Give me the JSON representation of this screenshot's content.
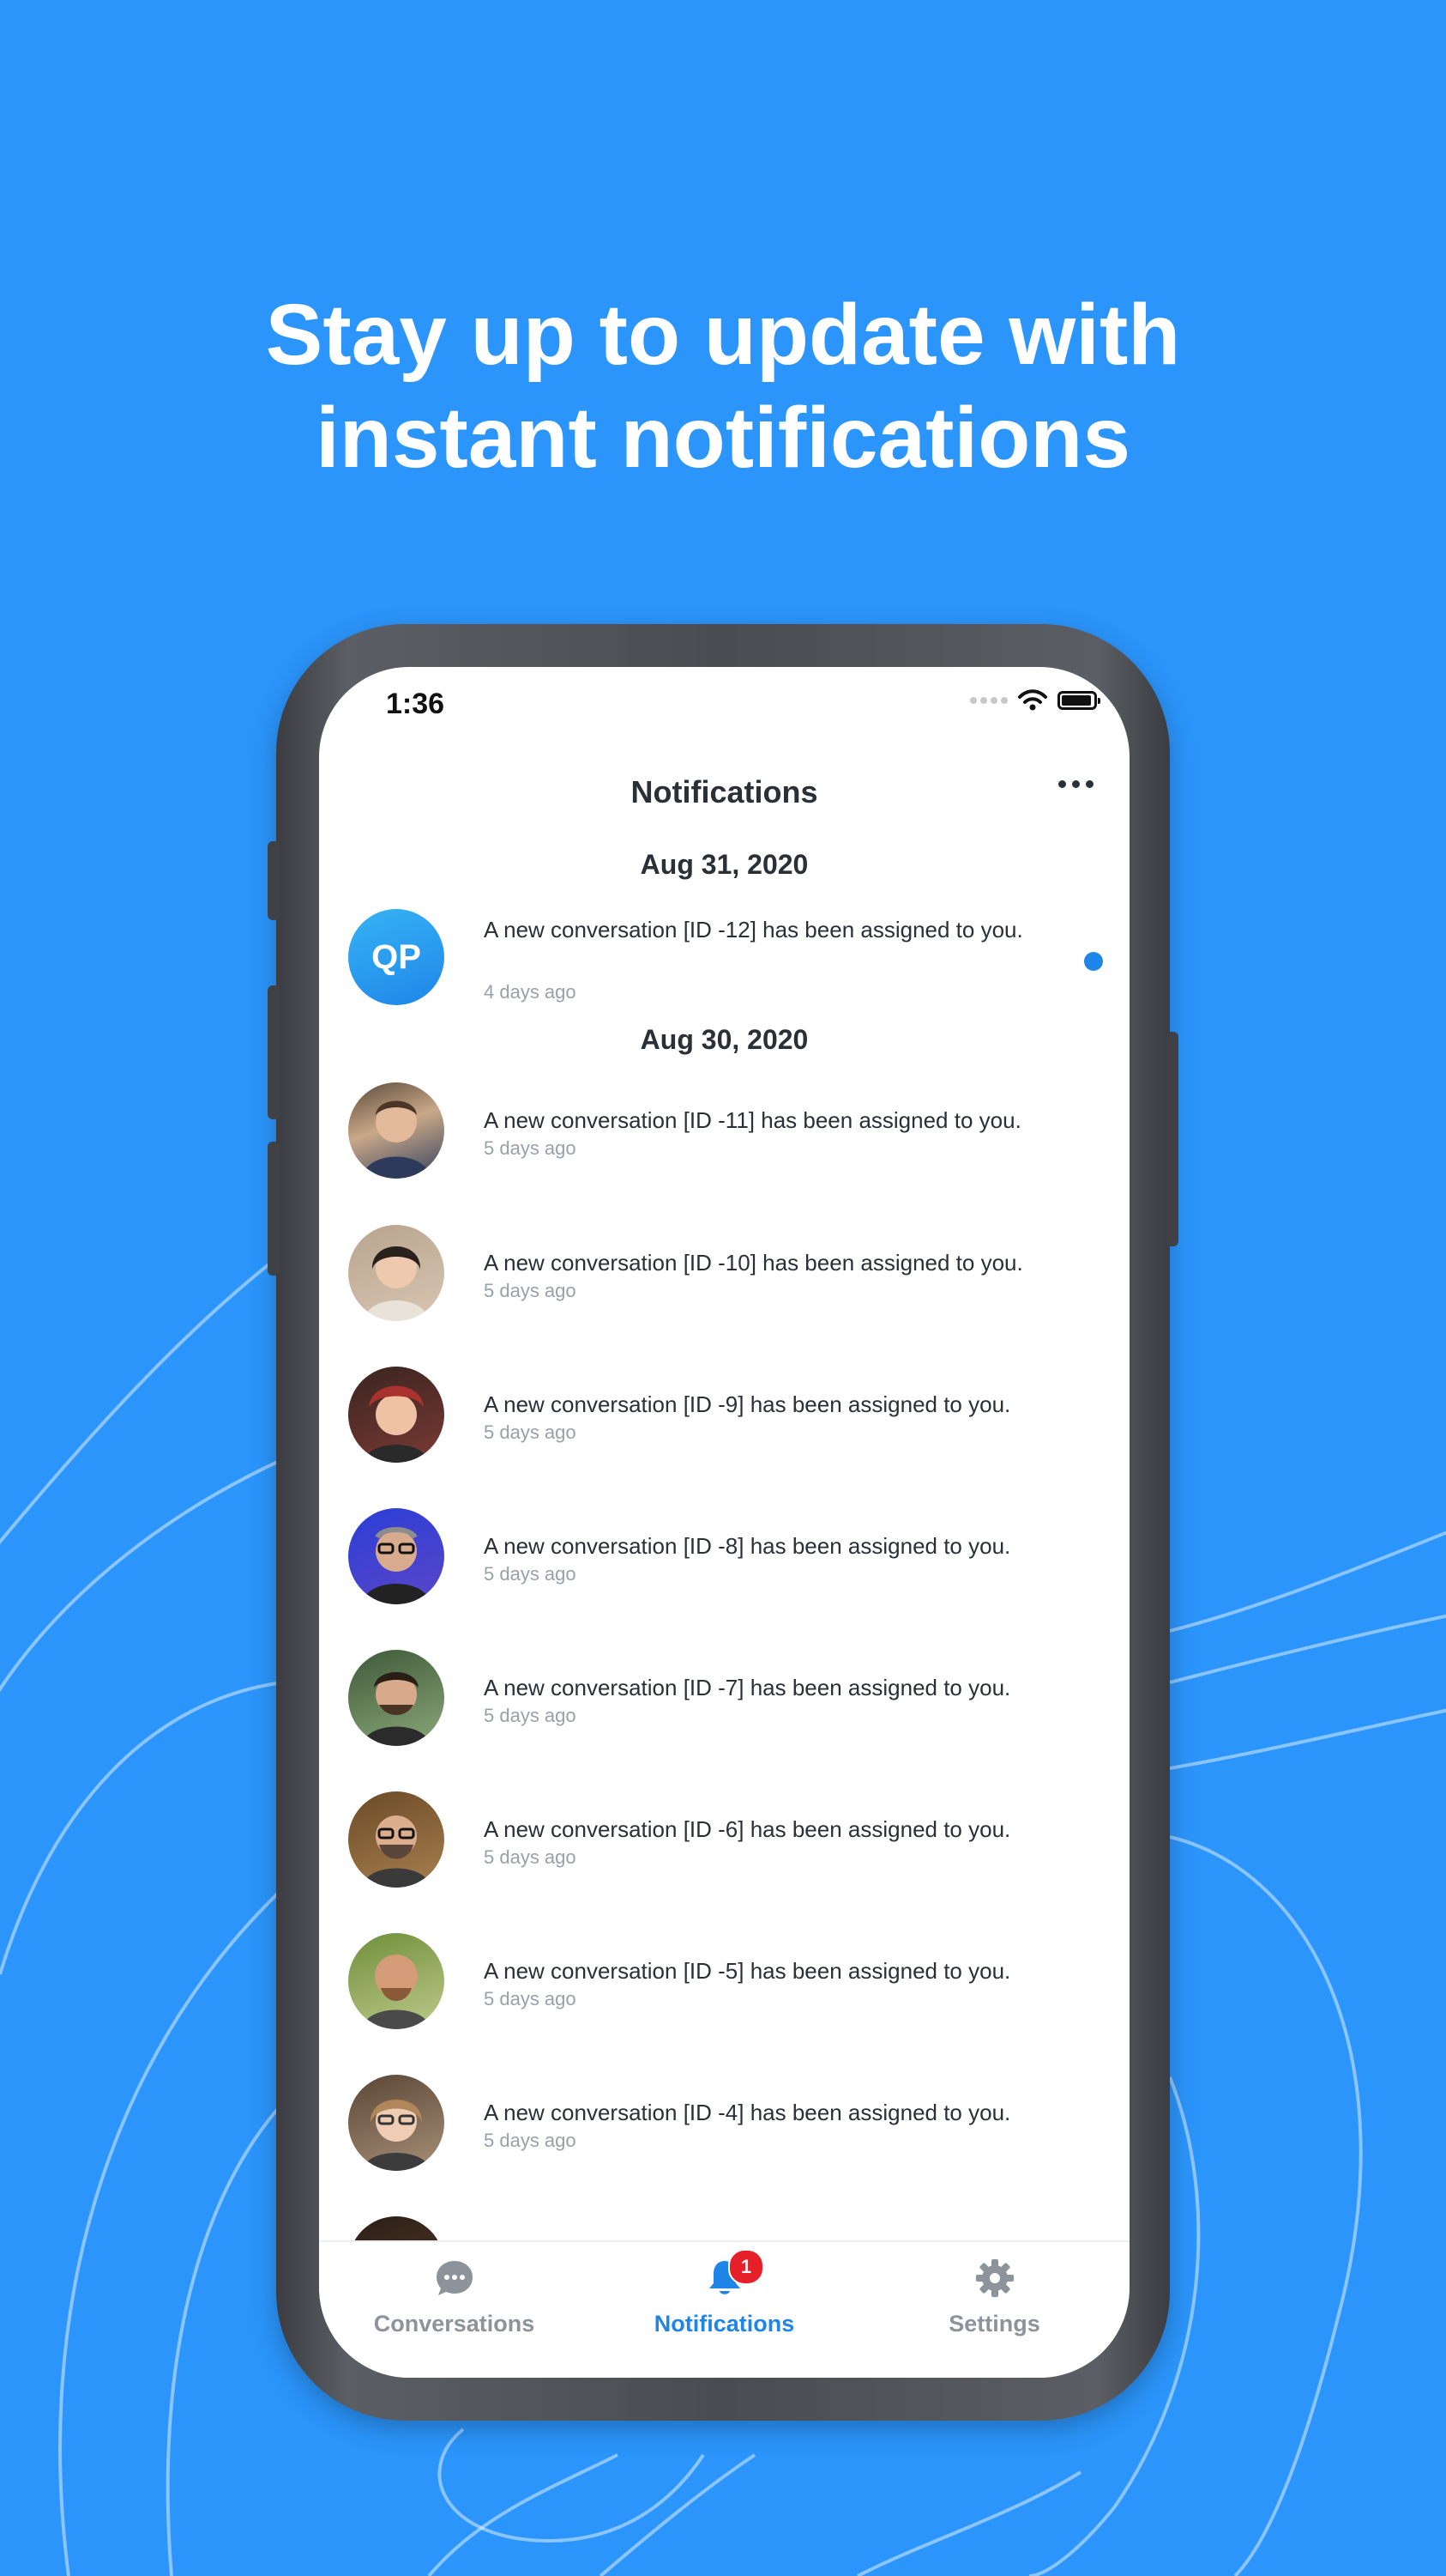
{
  "headline": {
    "line1": "Stay up to update with",
    "line2": "instant notifications"
  },
  "status_bar": {
    "time": "1:36"
  },
  "header": {
    "title": "Notifications"
  },
  "sections": [
    {
      "date": "Aug 31, 2020",
      "items": [
        {
          "avatar_type": "initials",
          "initials": "QP",
          "message": "A new conversation [ID -12] has been assigned to you.",
          "time": "4 days ago",
          "unread": true
        }
      ]
    },
    {
      "date": "Aug 30, 2020",
      "items": [
        {
          "avatar_type": "photo",
          "message": "A new conversation [ID -11] has been assigned to you.",
          "time": "5 days ago"
        },
        {
          "avatar_type": "photo",
          "message": "A new conversation [ID -10] has been assigned to you.",
          "time": "5 days ago"
        },
        {
          "avatar_type": "photo",
          "message": "A new conversation [ID -9] has been assigned to you.",
          "time": "5 days ago"
        },
        {
          "avatar_type": "photo",
          "message": "A new conversation [ID -8] has been assigned to you.",
          "time": "5 days ago"
        },
        {
          "avatar_type": "photo",
          "message": "A new conversation [ID -7] has been assigned to you.",
          "time": "5 days ago"
        },
        {
          "avatar_type": "photo",
          "message": "A new conversation [ID -6] has been assigned to you.",
          "time": "5 days ago"
        },
        {
          "avatar_type": "photo",
          "message": "A new conversation [ID -5] has been assigned to you.",
          "time": "5 days ago"
        },
        {
          "avatar_type": "photo",
          "message": "A new conversation [ID -4] has been assigned to you.",
          "time": "5 days ago"
        }
      ]
    }
  ],
  "tabbar": {
    "tabs": [
      {
        "label": "Conversations",
        "icon": "chat-bubble-icon",
        "active": false
      },
      {
        "label": "Notifications",
        "icon": "bell-icon",
        "active": true,
        "badge": "1"
      },
      {
        "label": "Settings",
        "icon": "gear-icon",
        "active": false
      }
    ]
  },
  "colors": {
    "background": "#2b95fb",
    "accent": "#1f86e8",
    "badge": "#e5202b"
  }
}
